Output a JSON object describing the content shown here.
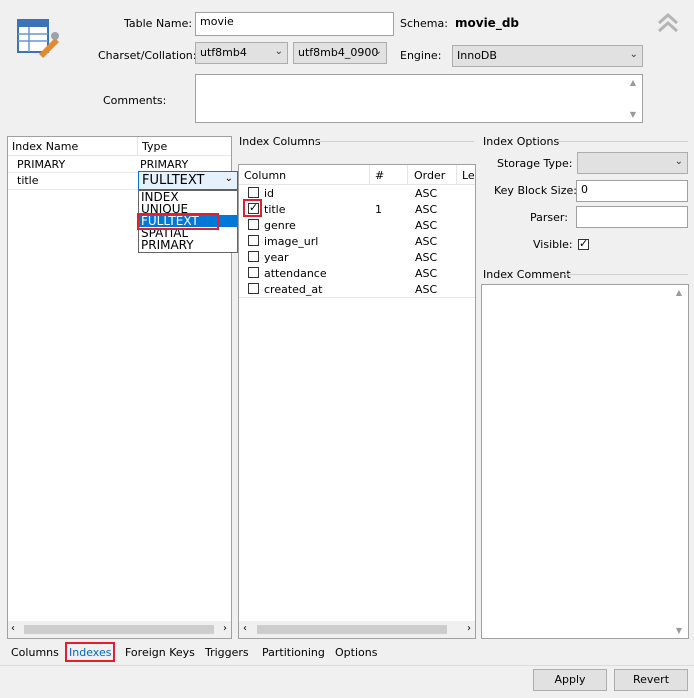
{
  "header": {
    "table_name_label": "Table Name:",
    "table_name_value": "movie",
    "schema_label": "Schema:",
    "schema_value": "movie_db",
    "charset_label": "Charset/Collation:",
    "charset_value": "utf8mb4",
    "collation_value": "utf8mb4_0900",
    "engine_label": "Engine:",
    "engine_value": "InnoDB",
    "comments_label": "Comments:",
    "comments_value": ""
  },
  "index_list": {
    "col_name": "Index Name",
    "col_type": "Type",
    "rows": [
      {
        "name": "PRIMARY",
        "type": "PRIMARY"
      },
      {
        "name": "title",
        "type": "FULLTEXT"
      }
    ],
    "type_dropdown": {
      "selected": "FULLTEXT",
      "options": [
        "INDEX",
        "UNIQUE",
        "FULLTEXT",
        "SPATIAL",
        "PRIMARY"
      ]
    }
  },
  "index_columns": {
    "title": "Index Columns",
    "headers": [
      "Column",
      "#",
      "Order",
      "Ler"
    ],
    "rows": [
      {
        "checked": false,
        "name": "id",
        "num": "",
        "order": "ASC"
      },
      {
        "checked": true,
        "name": "title",
        "num": "1",
        "order": "ASC"
      },
      {
        "checked": false,
        "name": "genre",
        "num": "",
        "order": "ASC"
      },
      {
        "checked": false,
        "name": "image_url",
        "num": "",
        "order": "ASC"
      },
      {
        "checked": false,
        "name": "year",
        "num": "",
        "order": "ASC"
      },
      {
        "checked": false,
        "name": "attendance",
        "num": "",
        "order": "ASC"
      },
      {
        "checked": false,
        "name": "created_at",
        "num": "",
        "order": "ASC"
      }
    ]
  },
  "index_options": {
    "title": "Index Options",
    "storage_type_label": "Storage Type:",
    "storage_type_value": "",
    "key_block_label": "Key Block Size:",
    "key_block_value": "0",
    "parser_label": "Parser:",
    "parser_value": "",
    "visible_label": "Visible:",
    "visible_checked": true,
    "comment_title": "Index Comment"
  },
  "tabs": [
    "Columns",
    "Indexes",
    "Foreign Keys",
    "Triggers",
    "Partitioning",
    "Options"
  ],
  "active_tab": "Indexes",
  "buttons": {
    "apply": "Apply",
    "revert": "Revert"
  },
  "colors": {
    "highlight": "#e0202a",
    "selection": "#0078d7",
    "active_tab_text": "#0066cc"
  },
  "icons": {
    "table": "table-edit-icon",
    "collapse": "double-chevron-up-icon"
  }
}
